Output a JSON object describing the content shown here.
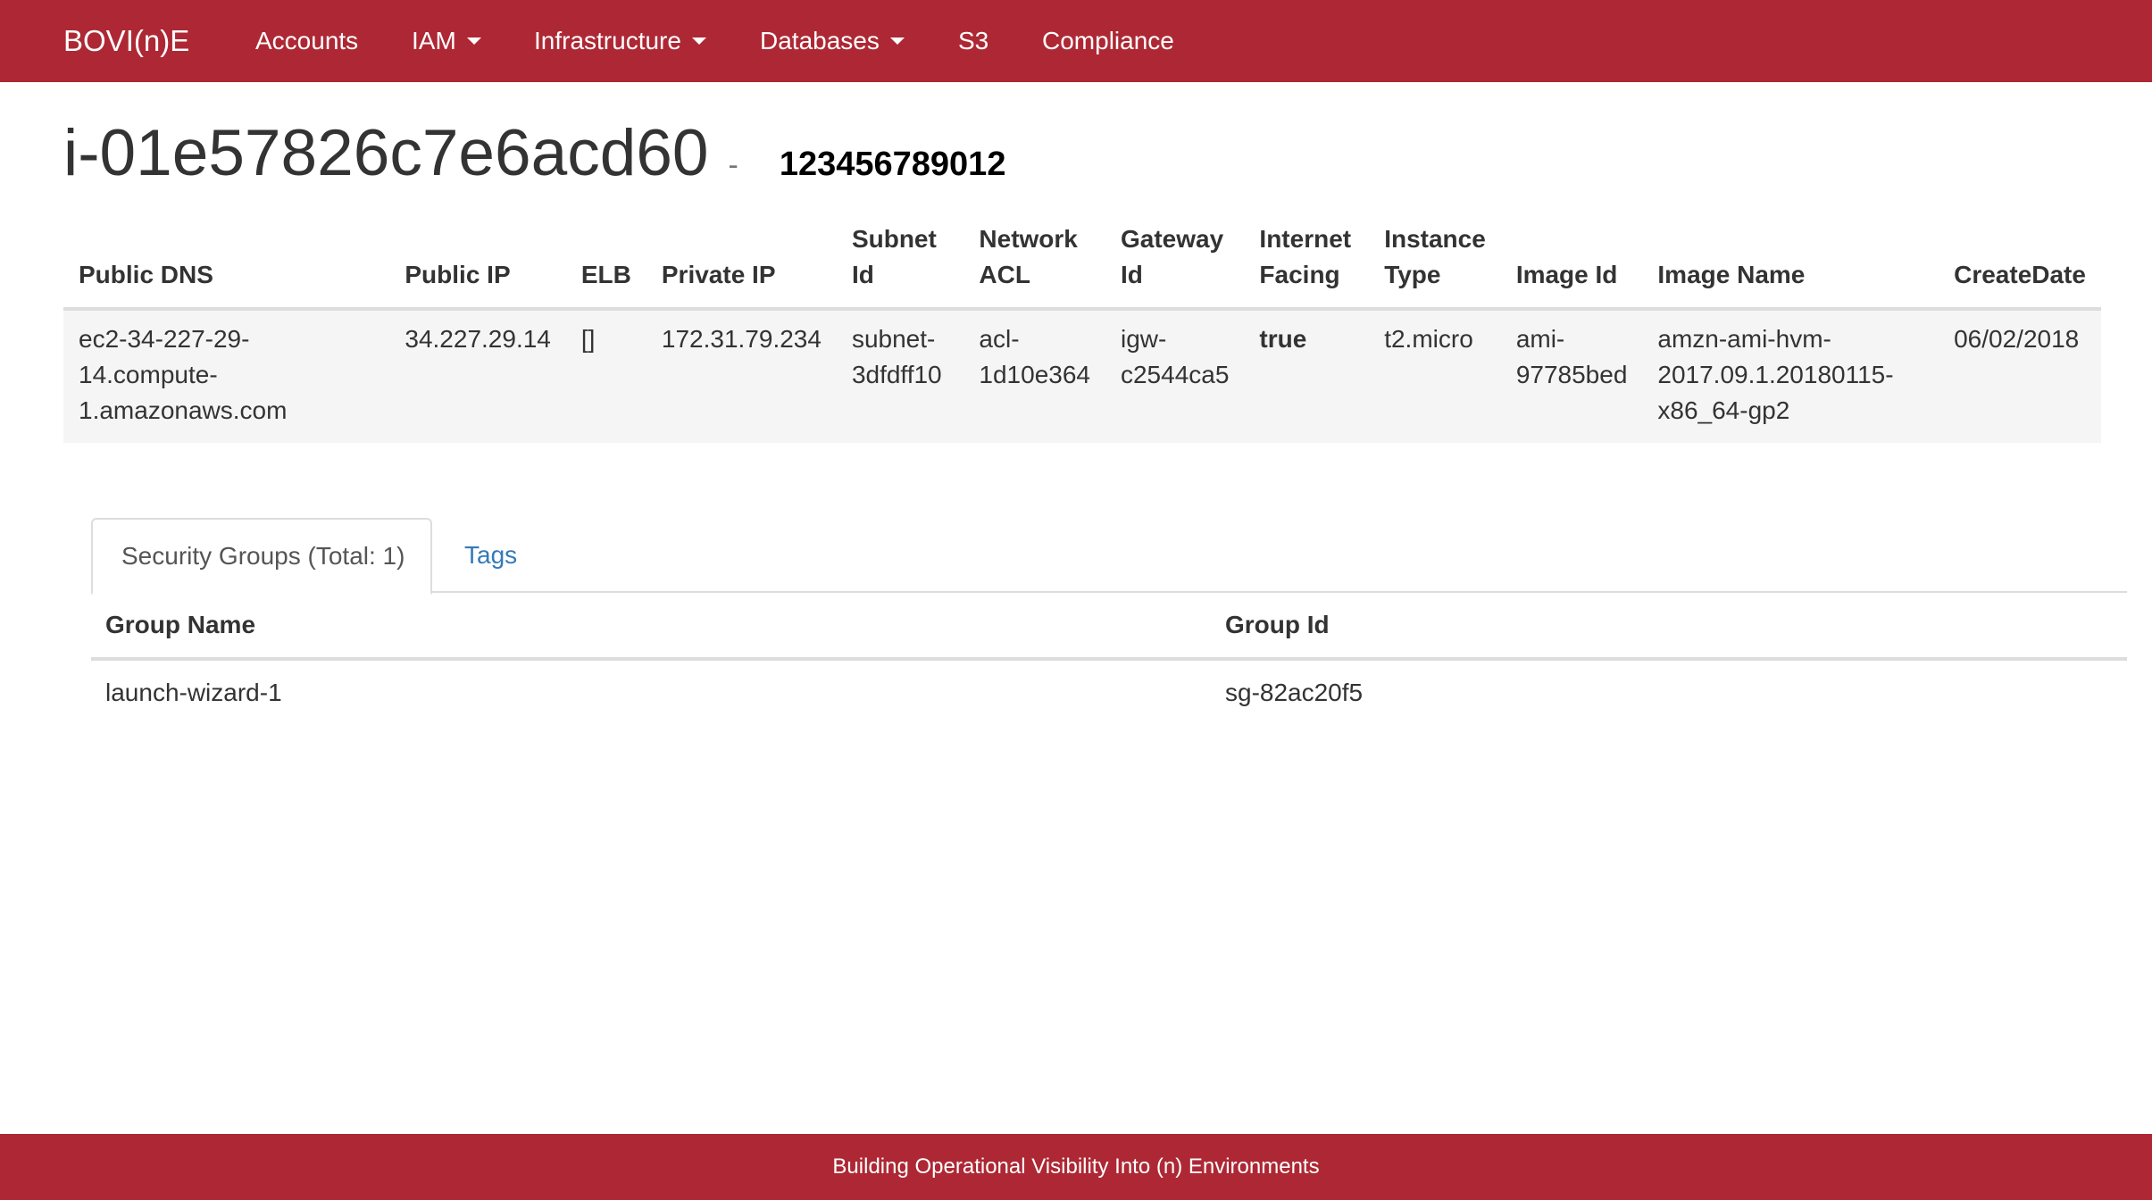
{
  "nav": {
    "brand": "BOVI(n)E",
    "items": [
      {
        "label": "Accounts",
        "dropdown": false
      },
      {
        "label": "IAM",
        "dropdown": true
      },
      {
        "label": "Infrastructure",
        "dropdown": true
      },
      {
        "label": "Databases",
        "dropdown": true
      },
      {
        "label": "S3",
        "dropdown": false
      },
      {
        "label": "Compliance",
        "dropdown": false
      }
    ]
  },
  "header": {
    "instance_id": "i-01e57826c7e6acd60",
    "separator": "-",
    "account_id": "123456789012"
  },
  "instance_table": {
    "headers": {
      "public_dns": "Public DNS",
      "public_ip": "Public IP",
      "elb": "ELB",
      "private_ip": "Private IP",
      "subnet_id": "Subnet Id",
      "network_acl": "Network ACL",
      "gateway_id": "Gateway Id",
      "internet_facing": "Internet Facing",
      "instance_type": "Instance Type",
      "image_id": "Image Id",
      "image_name": "Image Name",
      "create_date": "CreateDate"
    },
    "row": {
      "public_dns": "ec2-34-227-29-14.compute-1.amazonaws.com",
      "public_ip": "34.227.29.14",
      "elb": "[]",
      "private_ip": "172.31.79.234",
      "subnet_id": "subnet-3dfdff10",
      "network_acl": "acl-1d10e364",
      "gateway_id": "igw-c2544ca5",
      "internet_facing": "true",
      "instance_type": "t2.micro",
      "image_id": "ami-97785bed",
      "image_name": "amzn-ami-hvm-2017.09.1.20180115-x86_64-gp2",
      "create_date": "06/02/2018"
    }
  },
  "tabs": {
    "security_groups": "Security Groups (Total: 1)",
    "tags": "Tags"
  },
  "security_groups": {
    "headers": {
      "group_name": "Group Name",
      "group_id": "Group Id"
    },
    "rows": [
      {
        "group_name": "launch-wizard-1",
        "group_id": "sg-82ac20f5"
      }
    ]
  },
  "footer": {
    "text": "Building Operational Visibility Into (n) Environments"
  },
  "colors": {
    "brand": "#ad2834",
    "link": "#337ab7",
    "row_background": "#f5f5f5"
  }
}
